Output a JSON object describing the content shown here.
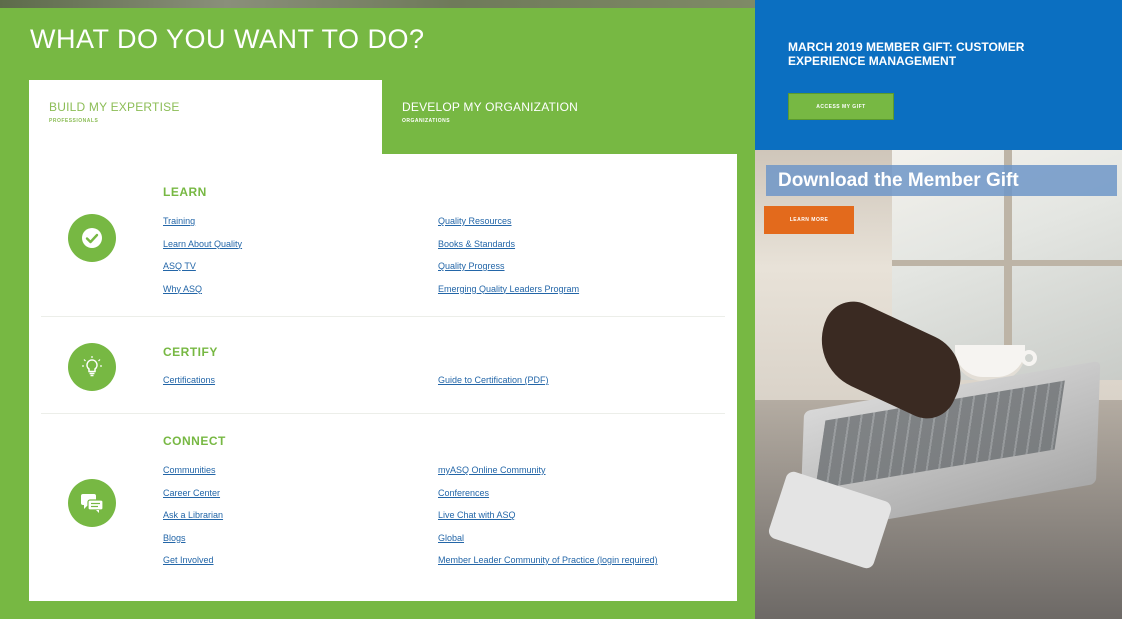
{
  "headline": "WHAT DO YOU WANT TO DO?",
  "tabs": [
    {
      "title": "BUILD MY EXPERTISE",
      "subtitle": "PROFESSIONALS"
    },
    {
      "title": "DEVELOP MY ORGANIZATION",
      "subtitle": "ORGANIZATIONS"
    }
  ],
  "sections": {
    "learn": {
      "title": "LEARN",
      "icon": "check-icon",
      "col1": [
        "Training",
        "Learn About Quality",
        "ASQ TV",
        "Why ASQ"
      ],
      "col2": [
        "Quality Resources",
        "Books & Standards",
        "Quality Progress",
        "Emerging Quality Leaders Program"
      ]
    },
    "certify": {
      "title": "CERTIFY",
      "icon": "lightbulb-icon",
      "col1": [
        "Certifications"
      ],
      "col2": [
        "Guide to Certification (PDF)"
      ]
    },
    "connect": {
      "title": "CONNECT",
      "icon": "chat-bubbles-icon",
      "col1": [
        "Communities",
        "Career Center",
        "Ask a Librarian",
        "Blogs",
        "Get Involved"
      ],
      "col2": [
        "myASQ Online Community",
        "Conferences",
        "Live Chat with ASQ",
        "Global",
        "Member Leader Community of Practice (login required)"
      ]
    }
  },
  "promo": {
    "title": "MARCH 2019 MEMBER GIFT: CUSTOMER EXPERIENCE MANAGEMENT",
    "button": "ACCESS MY GIFT"
  },
  "banner": {
    "title": "Download the Member Gift",
    "button": "LEARN MORE"
  },
  "colors": {
    "brand_green": "#77b843",
    "promo_blue": "#0b6fc1",
    "link_blue": "#2366a8",
    "cta_orange": "#e36a1c"
  }
}
